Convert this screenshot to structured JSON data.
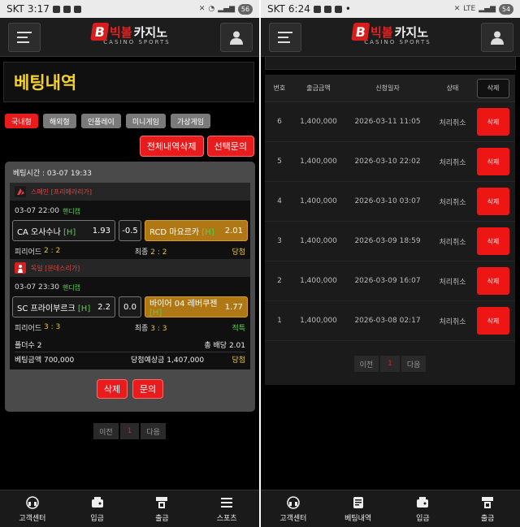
{
  "left": {
    "status": {
      "carrier": "SKT",
      "time": "3:17",
      "battery": "56"
    },
    "logo": {
      "b": "B",
      "red": "빅볼",
      "white": "카지노",
      "sub": "CASINO SPORTS"
    },
    "title": "베팅내역",
    "tabs": [
      "국내형",
      "해외형",
      "인플레이",
      "미니게임",
      "가상게임"
    ],
    "actions": {
      "delete_all": "전체내역삭제",
      "inquiry": "선택문의"
    },
    "bet": {
      "time_label": "베팅시간 : 03-07 19:33",
      "matches": [
        {
          "league": "스페인 [프리메라리가]",
          "league_color": "#d22a2a",
          "match_time": "03-07 22:00",
          "market": "핸디캡",
          "home": "CA 오사수나",
          "home_mark": "[H]",
          "home_odds": "1.93",
          "line": "-0.5",
          "away": "RCD 마요르카",
          "away_mark": "[H]",
          "away_odds": "2.01",
          "half_label": "피리어드",
          "half_score": "2 : 2",
          "final_label": "최종",
          "final_score": "2 : 2",
          "result": "당첨"
        },
        {
          "league": "독일 [분데스리가]",
          "league_color": "#d22a2a",
          "match_time": "03-07 23:30",
          "market": "핸디캡",
          "home": "SC 프라이부르크",
          "home_mark": "[H]",
          "home_odds": "2.2",
          "line": "0.0",
          "away": "바이어 04 레버쿠젠",
          "away_mark": "[H]",
          "away_odds": "1.77",
          "half_label": "피리어드",
          "half_score": "3 : 3",
          "final_label": "최종",
          "final_score": "3 : 3",
          "result": "적특"
        }
      ],
      "folder_count": "폴더수 2",
      "total_odds": "총 배당 2.01",
      "bet_amount": "베팅금액 700,000",
      "expected_win": "당첨예상금 1,407,000",
      "status": "당첨",
      "delete": "삭제",
      "inquiry": "문의"
    },
    "pager": {
      "prev": "이전",
      "page": "1",
      "next": "다음"
    },
    "nav": [
      "고객센터",
      "입금",
      "출금",
      "스포츠"
    ]
  },
  "right": {
    "status": {
      "carrier": "SKT",
      "time": "6:24",
      "battery": "54",
      "net": "LTE"
    },
    "table": {
      "headers": {
        "no": "번호",
        "amount": "출금금액",
        "date": "신청일자",
        "state": "상태",
        "action": "삭제"
      },
      "rows": [
        {
          "no": "6",
          "amount": "1,400,000",
          "date": "2026-03-11 11:05",
          "state": "처리취소",
          "action": "삭제"
        },
        {
          "no": "5",
          "amount": "1,400,000",
          "date": "2026-03-10 22:02",
          "state": "처리취소",
          "action": "삭제"
        },
        {
          "no": "4",
          "amount": "1,400,000",
          "date": "2026-03-10 03:07",
          "state": "처리취소",
          "action": "삭제"
        },
        {
          "no": "3",
          "amount": "1,400,000",
          "date": "2026-03-09 18:59",
          "state": "처리취소",
          "action": "삭제"
        },
        {
          "no": "2",
          "amount": "1,400,000",
          "date": "2026-03-09 16:07",
          "state": "처리취소",
          "action": "삭제"
        },
        {
          "no": "1",
          "amount": "1,400,000",
          "date": "2026-03-08 02:17",
          "state": "처리취소",
          "action": "삭제"
        }
      ]
    },
    "pager": {
      "prev": "이전",
      "page": "1",
      "next": "다음"
    },
    "nav": [
      "고객센터",
      "베팅내역",
      "입금",
      "출금"
    ]
  },
  "colors": {
    "accent": "#e81c1c",
    "yellow": "#f2d22a",
    "green": "#53d24a",
    "selected": "#b07814"
  }
}
